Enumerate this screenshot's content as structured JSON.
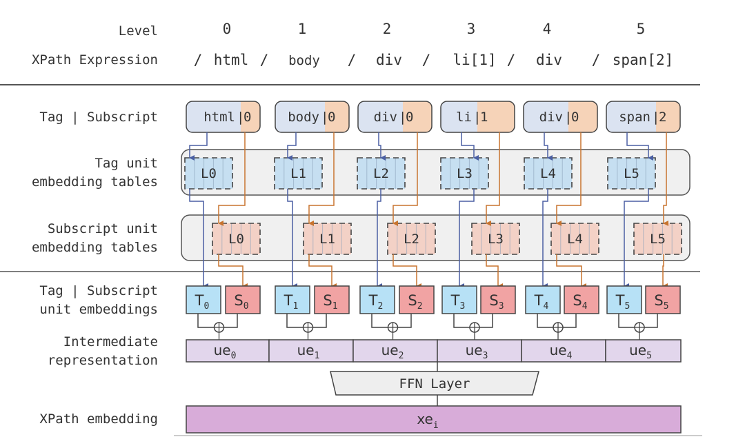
{
  "header": {
    "level_label": "Level",
    "xpath_label": "XPath Expression",
    "levels": [
      "0",
      "1",
      "2",
      "3",
      "4",
      "5"
    ],
    "xpath_parts": [
      "/",
      "html",
      "/",
      "body",
      "/",
      "div",
      "/",
      "li[1]",
      "/",
      "div",
      "/",
      "span[2]"
    ]
  },
  "row_labels": {
    "tag_subscript": "Tag | Subscript",
    "tag_tables": [
      "Tag unit",
      "embedding tables"
    ],
    "subscript_tables": [
      "Subscript unit",
      "embedding tables"
    ],
    "unit_embeddings": [
      "Tag | Subscript",
      "unit embeddings"
    ],
    "intermediate": [
      "Intermediate",
      "representation"
    ],
    "xpath_embedding": "XPath embedding"
  },
  "nodes": [
    {
      "tag": "html",
      "sep": "|",
      "subscript": "0"
    },
    {
      "tag": "body",
      "sep": "|",
      "subscript": "0"
    },
    {
      "tag": "div",
      "sep": "|",
      "subscript": "0"
    },
    {
      "tag": "li",
      "sep": "|",
      "subscript": "1"
    },
    {
      "tag": "div",
      "sep": "|",
      "subscript": "0"
    },
    {
      "tag": "span",
      "sep": "|",
      "subscript": "2"
    }
  ],
  "tag_tables": [
    "L0",
    "L1",
    "L2",
    "L3",
    "L4",
    "L5"
  ],
  "subscript_tables": [
    "L0",
    "L1",
    "L2",
    "L3",
    "L4",
    "L5"
  ],
  "unit_embeddings": [
    {
      "t": "T",
      "t_sub": "0",
      "s": "S",
      "s_sub": "0"
    },
    {
      "t": "T",
      "t_sub": "1",
      "s": "S",
      "s_sub": "1"
    },
    {
      "t": "T",
      "t_sub": "2",
      "s": "S",
      "s_sub": "2"
    },
    {
      "t": "T",
      "t_sub": "3",
      "s": "S",
      "s_sub": "3"
    },
    {
      "t": "T",
      "t_sub": "4",
      "s": "S",
      "s_sub": "4"
    },
    {
      "t": "T",
      "t_sub": "5",
      "s": "S",
      "s_sub": "5"
    }
  ],
  "intermediate": [
    {
      "base": "ue",
      "sub": "0"
    },
    {
      "base": "ue",
      "sub": "1"
    },
    {
      "base": "ue",
      "sub": "2"
    },
    {
      "base": "ue",
      "sub": "3"
    },
    {
      "base": "ue",
      "sub": "4"
    },
    {
      "base": "ue",
      "sub": "5"
    }
  ],
  "ffn_label": "FFN Layer",
  "output": {
    "base": "xe",
    "sub": "i"
  },
  "colors": {
    "tag_fill": "#dbe3f1",
    "subscript_fill": "#f6d3b8",
    "tag_table_fill": "#c6dff1",
    "subscript_table_fill": "#f3d1c6",
    "panel_fill": "#f0f0f0",
    "tag_arrow": "#4a5fa3",
    "subscript_arrow": "#c8742f",
    "t_box": "#b7e1f6",
    "s_box": "#f1a3a3",
    "ue_fill": "#e2d6ec",
    "ffn_fill": "#eeeeee",
    "xe_fill": "#d8acd9",
    "stroke": "#444444"
  }
}
